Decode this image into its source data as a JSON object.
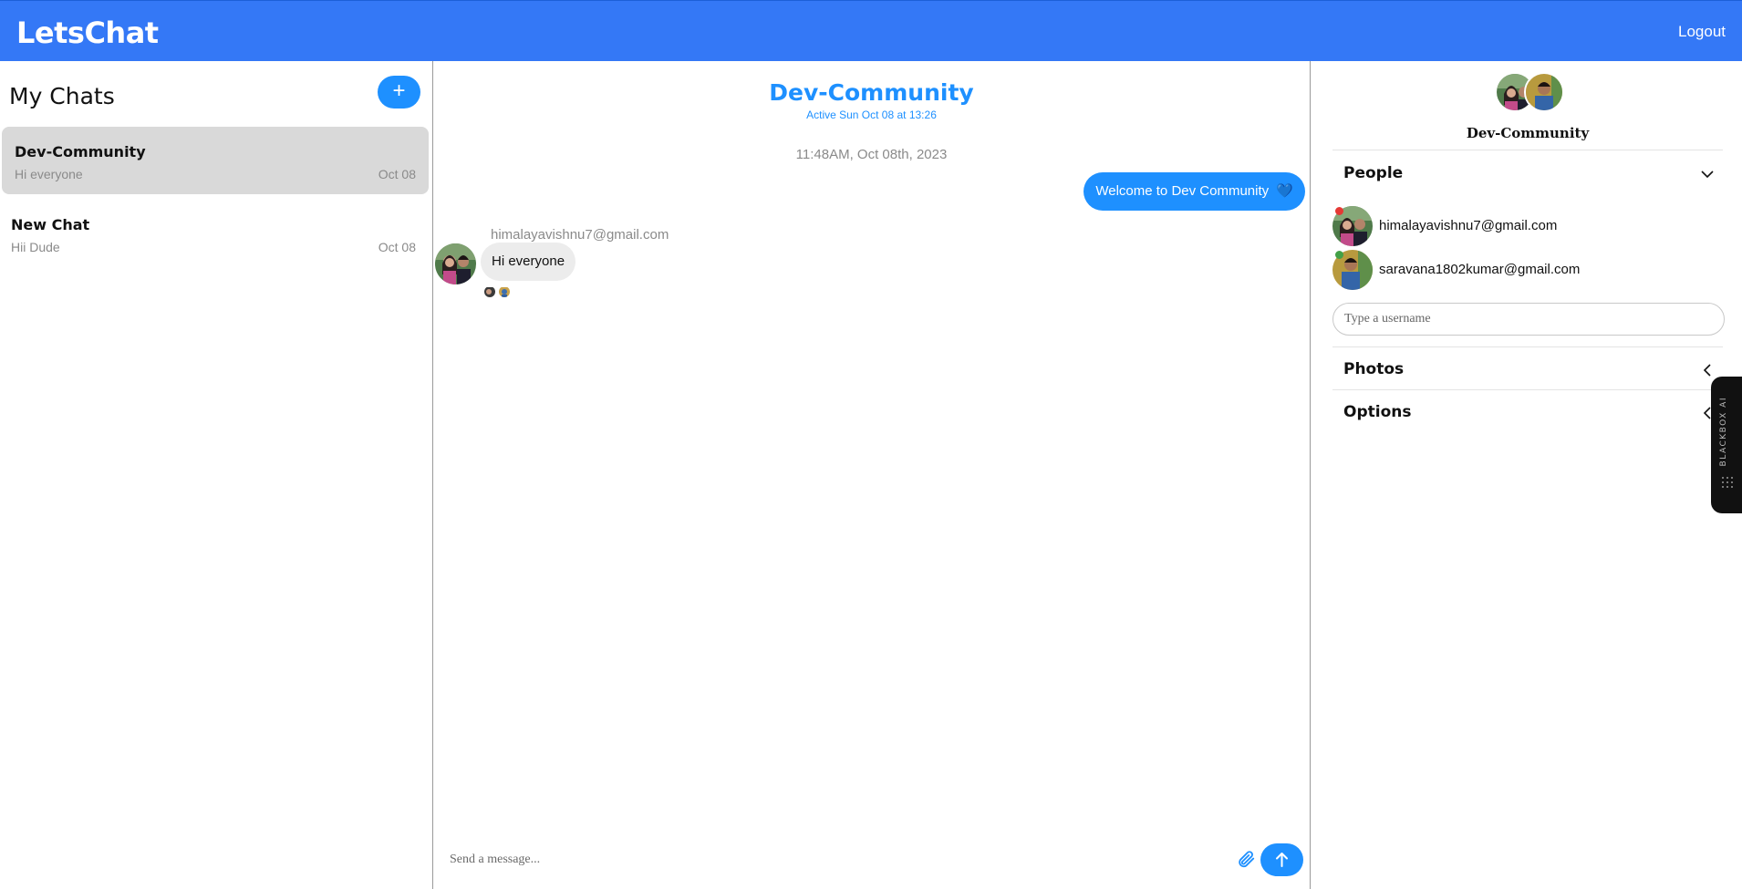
{
  "app": {
    "brand": "LetsChat",
    "logout_label": "Logout"
  },
  "sidebar": {
    "title": "My Chats",
    "new_chat_icon": "+",
    "chats": [
      {
        "name": "Dev-Community",
        "preview": "Hi everyone",
        "date": "Oct 08",
        "active": true
      },
      {
        "name": "New Chat",
        "preview": "Hii Dude",
        "date": "Oct 08",
        "active": false
      }
    ]
  },
  "conversation": {
    "title": "Dev-Community",
    "status": "Active Sun Oct 08 at 13:26",
    "timestamp": "11:48AM, Oct 08th, 2023",
    "messages": [
      {
        "direction": "outgoing",
        "text": "Welcome to Dev Community",
        "emoji": "💙"
      },
      {
        "direction": "incoming",
        "sender": "himalayavishnu7@gmail.com",
        "text": "Hi everyone"
      }
    ],
    "composer_placeholder": "Send a message...",
    "accent": "#1e90ff"
  },
  "details": {
    "group_name": "Dev-Community",
    "people_label": "People",
    "people": [
      {
        "email": "himalayavishnu7@gmail.com",
        "status_color": "#e53935"
      },
      {
        "email": "saravana1802kumar@gmail.com",
        "status_color": "#43a047"
      }
    ],
    "username_placeholder": "Type a username",
    "photos_label": "Photos",
    "options_label": "Options"
  },
  "blackbox": {
    "label": "BLACKBOX AI"
  }
}
